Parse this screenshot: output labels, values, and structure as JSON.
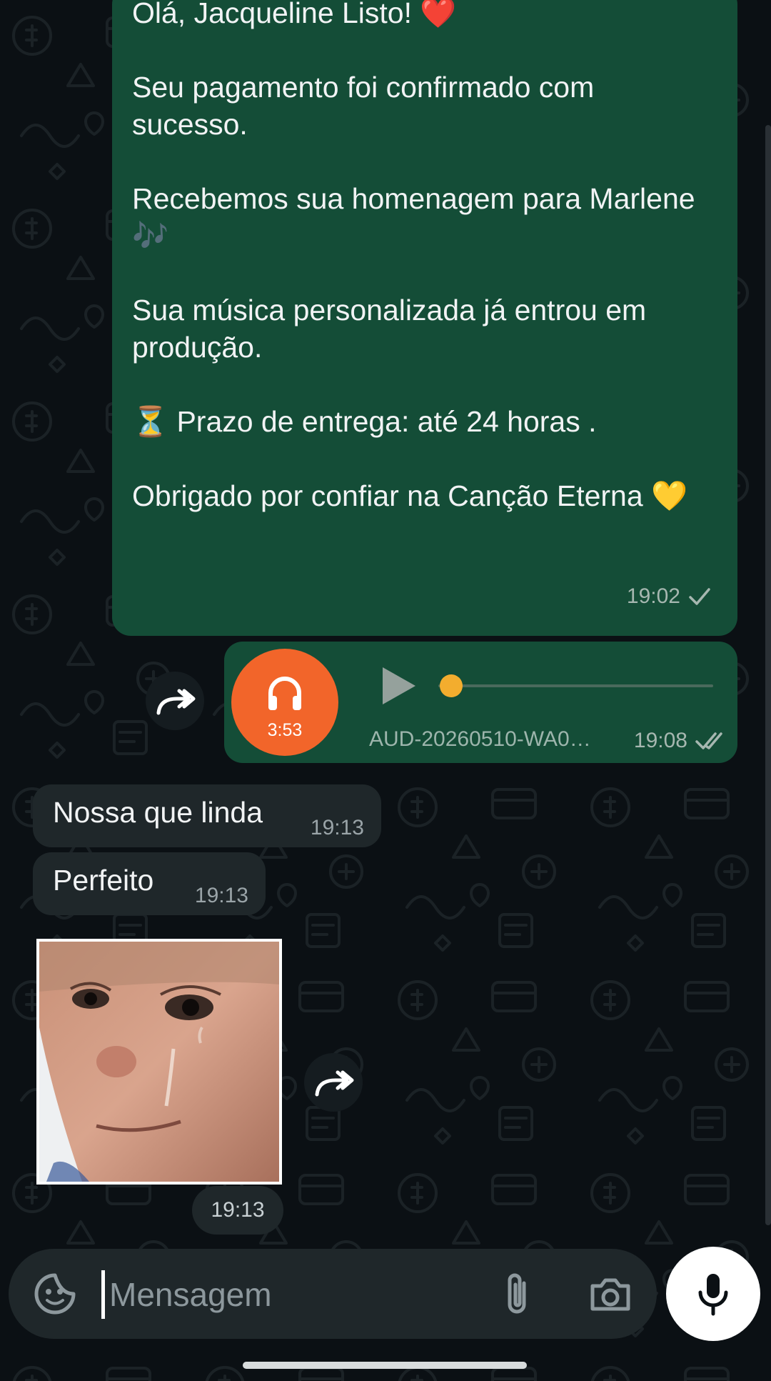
{
  "conversation": {
    "outgoing_message": {
      "text": "Olá, Jacqueline Listo! ❤️\n\nSeu pagamento foi confirmado com sucesso.\n\nRecebemos sua homenagem para Marlene 🎶\n\nSua música personalizada já entrou em produção.\n\n⏳ Prazo de entrega: até 24 horas .\n\nObrigado por confiar na Canção Eterna 💛",
      "time": "19:02"
    },
    "audio_message": {
      "duration": "3:53",
      "file_name": "AUD-20260510-WA0…",
      "time": "19:08",
      "progress": 0
    },
    "incoming_messages": [
      {
        "text": "Nossa que linda",
        "time": "19:13"
      },
      {
        "text": "Perfeito",
        "time": "19:13"
      }
    ],
    "sticker": {
      "time": "19:13"
    }
  },
  "composer": {
    "placeholder": "Mensagem"
  },
  "colors": {
    "outgoing_bubble": "#144d37",
    "incoming_bubble": "#1f272a",
    "audio_avatar": "#f2652a",
    "audio_knob": "#f3ad2e",
    "background": "#0b1014"
  },
  "icons": [
    "forward-icon",
    "headphones-icon",
    "play-icon",
    "single-check-icon",
    "double-check-icon",
    "sticker-icon",
    "attach-icon",
    "camera-icon",
    "mic-icon"
  ]
}
